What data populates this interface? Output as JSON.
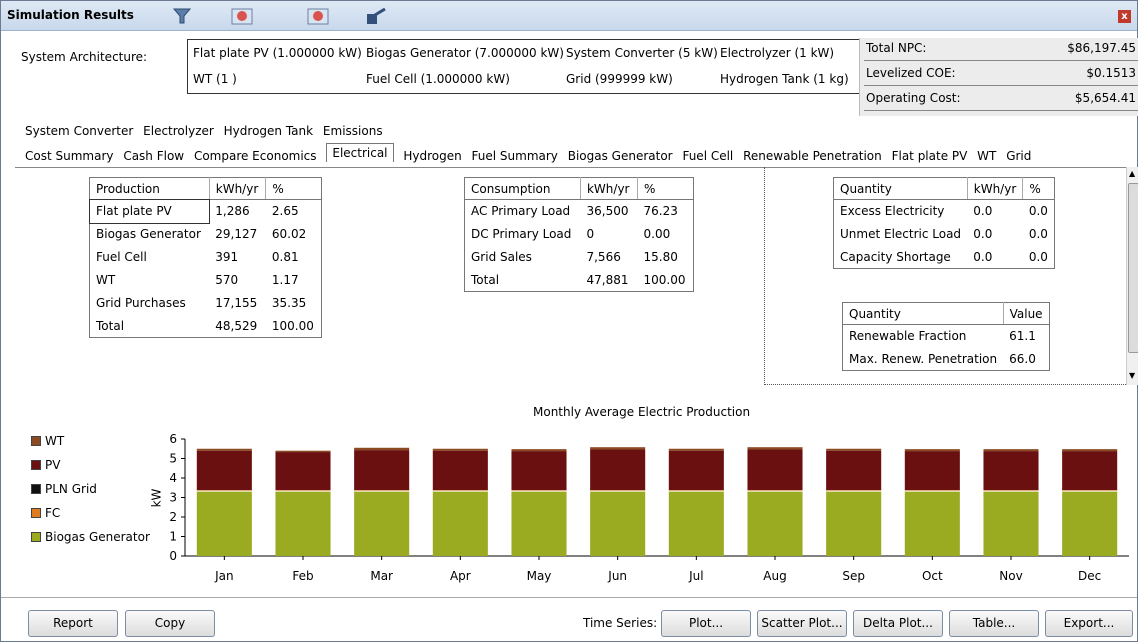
{
  "window": {
    "title": "Simulation Results",
    "close_glyph": "x"
  },
  "architecture": {
    "label": "System Architecture:",
    "items": [
      "Flat plate PV (1.000000 kW)",
      "Biogas Generator (7.000000 kW)",
      "System Converter (5 kW)",
      "Electrolyzer (1 kW)",
      "WT  (1 )",
      "Fuel Cell (1.000000 kW)",
      "Grid (999999 kW)",
      "Hydrogen Tank (1 kg)"
    ]
  },
  "summary": [
    {
      "label": "Total NPC:",
      "value": "$86,197.45"
    },
    {
      "label": "Levelized COE:",
      "value": "$0.1513"
    },
    {
      "label": "Operating Cost:",
      "value": "$5,654.41"
    }
  ],
  "tabs_row1": [
    "System Converter",
    "Electrolyzer",
    "Hydrogen Tank",
    "Emissions"
  ],
  "tabs_row2": [
    "Cost Summary",
    "Cash Flow",
    "Compare Economics",
    "Electrical",
    "Hydrogen",
    "Fuel Summary",
    "Biogas Generator",
    "Fuel Cell",
    "Renewable Penetration",
    "Flat plate PV",
    "WT",
    "Grid"
  ],
  "active_tab": "Electrical",
  "production_table": {
    "headers": [
      "Production",
      "kWh/yr",
      "%"
    ],
    "rows": [
      [
        "Flat plate PV",
        "1,286",
        "2.65"
      ],
      [
        "Biogas Generator",
        "29,127",
        "60.02"
      ],
      [
        "Fuel Cell",
        "391",
        "0.81"
      ],
      [
        "WT",
        "570",
        "1.17"
      ],
      [
        "Grid Purchases",
        "17,155",
        "35.35"
      ],
      [
        "Total",
        "48,529",
        "100.00"
      ]
    ]
  },
  "consumption_table": {
    "headers": [
      "Consumption",
      "kWh/yr",
      "%"
    ],
    "rows": [
      [
        "AC Primary Load",
        "36,500",
        "76.23"
      ],
      [
        "DC Primary Load",
        "0",
        "0.00"
      ],
      [
        "Grid Sales",
        "7,566",
        "15.80"
      ],
      [
        "Total",
        "47,881",
        "100.00"
      ]
    ]
  },
  "quantity_table": {
    "headers": [
      "Quantity",
      "kWh/yr",
      "%"
    ],
    "rows": [
      [
        "Excess Electricity",
        "0.0",
        "0.0"
      ],
      [
        "Unmet Electric Load",
        "0.0",
        "0.0"
      ],
      [
        "Capacity Shortage",
        "0.0",
        "0.0"
      ]
    ]
  },
  "renewable_table": {
    "headers": [
      "Quantity",
      "Value"
    ],
    "rows": [
      [
        "Renewable Fraction",
        "61.1"
      ],
      [
        "Max. Renew. Penetration",
        "66.0"
      ]
    ]
  },
  "chart_data": {
    "type": "bar",
    "stacked": true,
    "title": "Monthly Average Electric Production",
    "xlabel": "",
    "ylabel": "kW",
    "ylim": [
      0,
      6
    ],
    "yticks": [
      "0",
      "1",
      "2",
      "3",
      "4",
      "5",
      "6"
    ],
    "categories": [
      "Jan",
      "Feb",
      "Mar",
      "Apr",
      "May",
      "Jun",
      "Jul",
      "Aug",
      "Sep",
      "Oct",
      "Nov",
      "Dec"
    ],
    "series": [
      {
        "name": "Biogas Generator",
        "color": "#9aab22",
        "values": [
          3.33,
          3.33,
          3.33,
          3.33,
          3.33,
          3.33,
          3.33,
          3.33,
          3.33,
          3.33,
          3.33,
          3.33
        ]
      },
      {
        "name": "FC",
        "color": "#e07b1f",
        "values": [
          0.05,
          0.05,
          0.05,
          0.05,
          0.05,
          0.05,
          0.05,
          0.05,
          0.05,
          0.05,
          0.05,
          0.05
        ]
      },
      {
        "name": "PLN Grid",
        "color": "#111111",
        "values": [
          0,
          0,
          0,
          0,
          0,
          0,
          0,
          0,
          0,
          0,
          0,
          0
        ]
      },
      {
        "name": "PV",
        "color": "#6b1010",
        "values": [
          2.02,
          1.95,
          2.05,
          2.02,
          2.0,
          2.08,
          2.02,
          2.08,
          2.02,
          2.0,
          2.0,
          2.0
        ]
      },
      {
        "name": "WT",
        "color": "#8a4a22",
        "values": [
          0.1,
          0.07,
          0.12,
          0.1,
          0.1,
          0.12,
          0.1,
          0.12,
          0.1,
          0.1,
          0.1,
          0.1
        ]
      }
    ],
    "legend_order": [
      "WT",
      "PV",
      "PLN Grid",
      "FC",
      "Biogas Generator"
    ],
    "legend_position": "left"
  },
  "bottom_bar": {
    "report": "Report",
    "copy": "Copy",
    "time_series_label": "Time Series:",
    "plot": "Plot...",
    "scatter_plot": "Scatter Plot...",
    "delta_plot": "Delta Plot...",
    "table": "Table...",
    "export": "Export..."
  }
}
